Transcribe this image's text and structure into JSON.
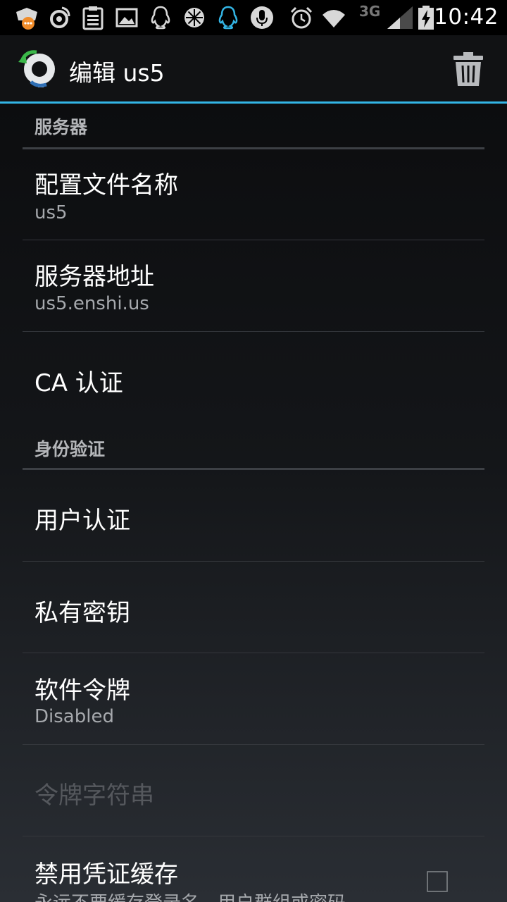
{
  "status_bar": {
    "time": "10:42",
    "network_label": "3G",
    "icons": [
      "chat-bubble-icon",
      "weibo-icon",
      "clipboard-icon",
      "image-icon",
      "qq-icon",
      "orange-slice-icon",
      "qq-blue-icon",
      "microphone-icon",
      "alarm-icon",
      "wifi-icon",
      "signal-icon",
      "battery-charging-icon"
    ]
  },
  "action_bar": {
    "title": "编辑 us5",
    "logo_icon": "openvpn-logo-icon",
    "delete_icon": "trash-icon",
    "accent_color": "#33b5e5"
  },
  "sections": {
    "server": {
      "header": "服务器",
      "profile_name": {
        "title": "配置文件名称",
        "summary": "us5"
      },
      "server_address": {
        "title": "服务器地址",
        "summary": "us5.enshi.us"
      },
      "ca_cert": {
        "title": "CA 认证"
      }
    },
    "auth": {
      "header": "身份验证",
      "user_cert": {
        "title": "用户认证"
      },
      "private_key": {
        "title": "私有密钥"
      },
      "soft_token": {
        "title": "软件令牌",
        "summary": "Disabled"
      },
      "token_string": {
        "title": "令牌字符串"
      },
      "disable_cache": {
        "title": "禁用凭证缓存",
        "summary": "永远不要缓存登录名、用户群组或密码",
        "checked": false
      }
    }
  }
}
